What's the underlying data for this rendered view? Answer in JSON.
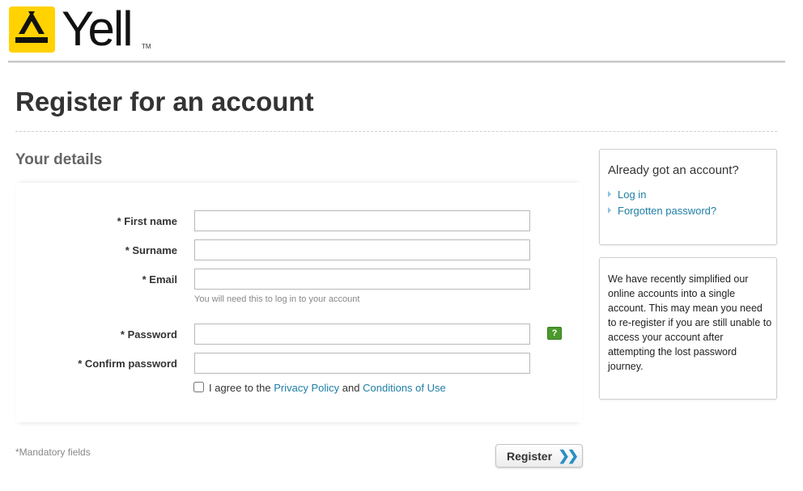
{
  "brand": {
    "name": "Yell",
    "tm": "TM",
    "logo_color": "#ffd200"
  },
  "page": {
    "title": "Register for an account",
    "section_title": "Your details"
  },
  "form": {
    "first_name_label": "* First name",
    "surname_label": "* Surname",
    "email_label": "* Email",
    "email_hint": "You will need this to log in to your account",
    "password_label": "* Password",
    "password_help": "?",
    "confirm_password_label": "* Confirm password",
    "agree_prefix": "I agree to the",
    "privacy_link": "Privacy Policy",
    "agree_and": "and",
    "conditions_link": "Conditions of Use",
    "mandatory_note": "*Mandatory fields",
    "register_label": "Register",
    "register_chevrons": "»"
  },
  "sidebar": {
    "login_box": {
      "heading": "Already got an account?",
      "links": [
        "Log in",
        "Forgotten password?"
      ]
    },
    "note_box": {
      "text": "We have recently simplified our online accounts into a single account. This may mean you need to re-register if you are still unable to access your account after attempting the lost password journey."
    }
  },
  "colors": {
    "link": "#1f7ea6",
    "help_badge": "#4a9a2c",
    "chevron": "#2a8fc4"
  }
}
